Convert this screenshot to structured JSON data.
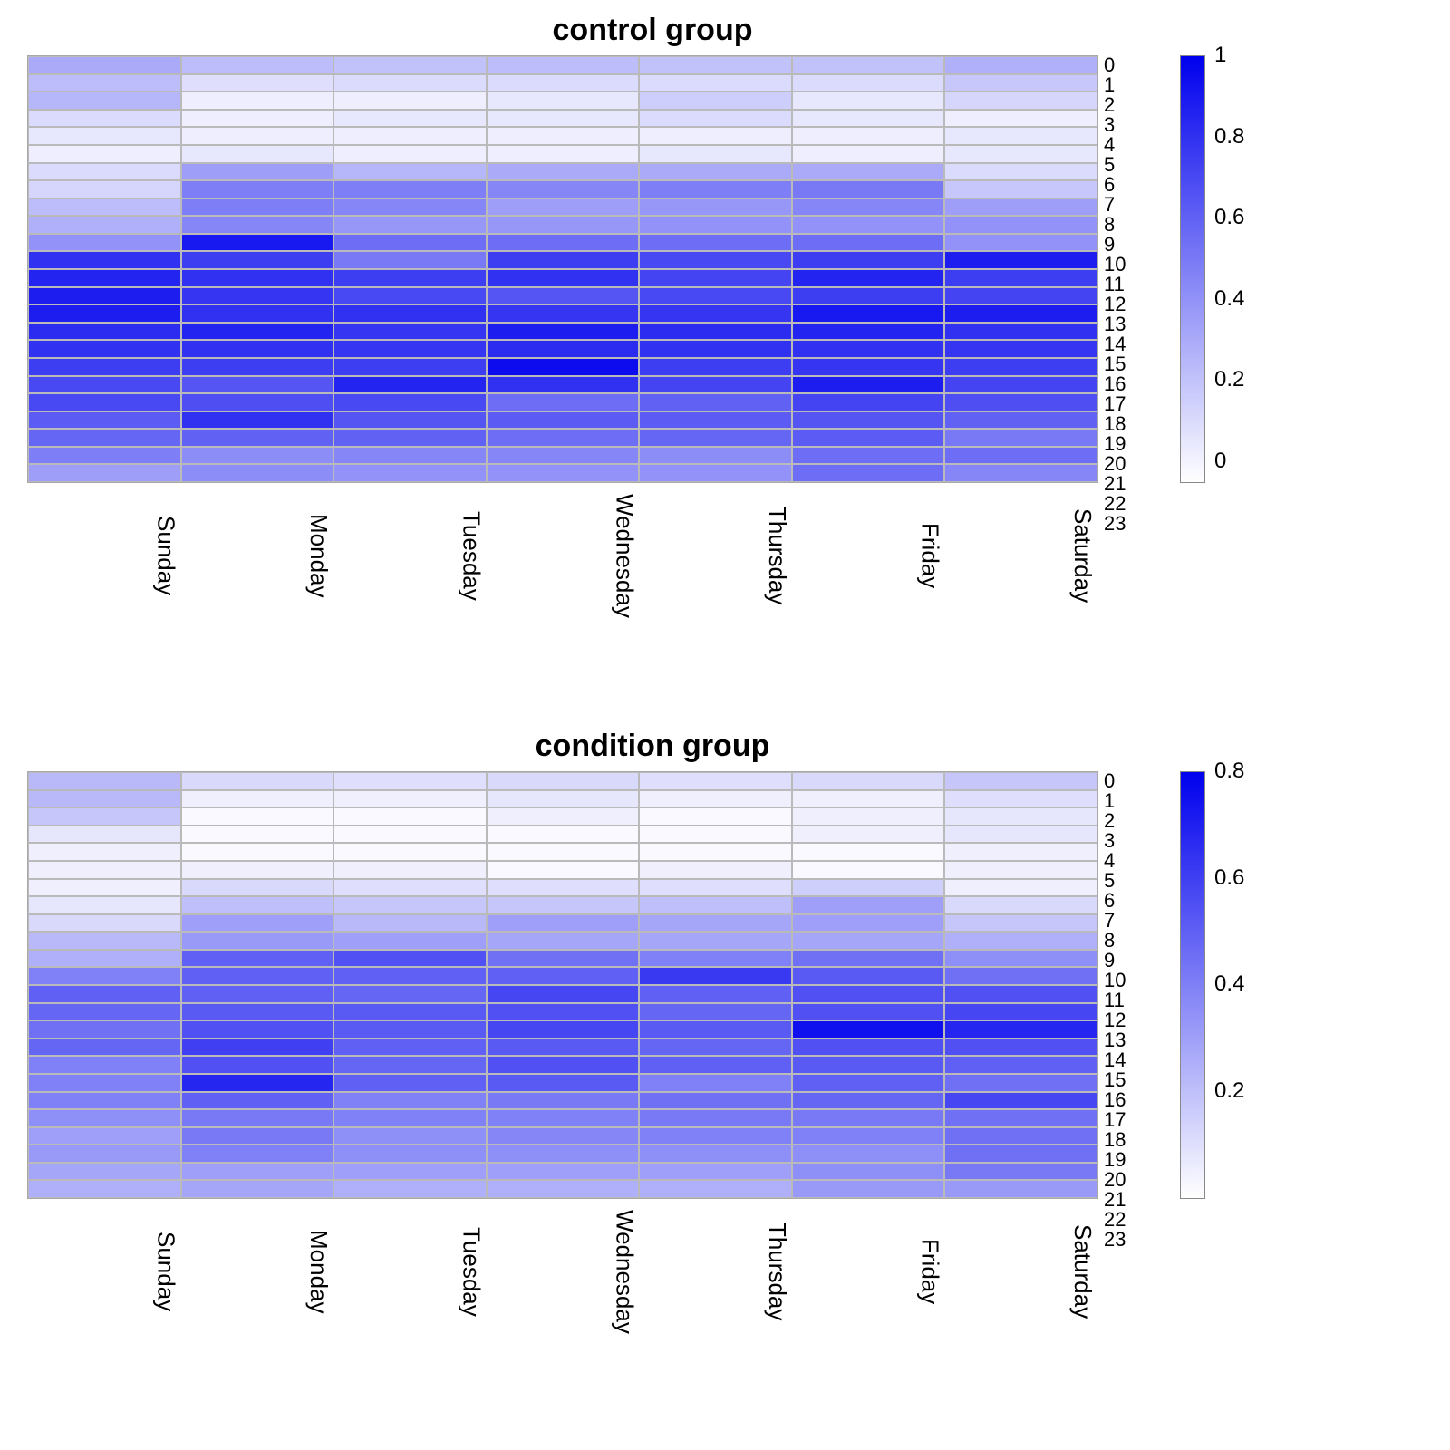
{
  "chart_data": [
    {
      "type": "heatmap",
      "title": "control group",
      "x_categories": [
        "Sunday",
        "Monday",
        "Tuesday",
        "Wednesday",
        "Thursday",
        "Friday",
        "Saturday"
      ],
      "y_categories": [
        "0",
        "1",
        "2",
        "3",
        "4",
        "5",
        "6",
        "7",
        "8",
        "9",
        "10",
        "11",
        "12",
        "13",
        "14",
        "15",
        "16",
        "17",
        "18",
        "19",
        "20",
        "21",
        "22",
        "23"
      ],
      "colorbar": {
        "min": -0.05,
        "max": 1.0,
        "ticks": [
          0,
          0.2,
          0.4,
          0.6,
          0.8,
          1
        ]
      },
      "colormap": {
        "low": "#ffffff",
        "high": "#0000ee"
      },
      "values": [
        [
          0.3,
          0.22,
          0.2,
          0.22,
          0.2,
          0.2,
          0.28
        ],
        [
          0.22,
          0.08,
          0.1,
          0.1,
          0.1,
          0.1,
          0.18
        ],
        [
          0.25,
          0.02,
          0.02,
          0.05,
          0.15,
          0.05,
          0.12
        ],
        [
          0.1,
          0.02,
          0.05,
          0.05,
          0.1,
          0.05,
          0.02
        ],
        [
          0.05,
          0.02,
          0.02,
          0.02,
          0.02,
          0.02,
          0.05
        ],
        [
          0.02,
          0.05,
          0.02,
          0.02,
          0.05,
          0.02,
          0.05
        ],
        [
          0.1,
          0.35,
          0.25,
          0.3,
          0.3,
          0.3,
          0.1
        ],
        [
          0.12,
          0.48,
          0.48,
          0.45,
          0.48,
          0.5,
          0.18
        ],
        [
          0.22,
          0.48,
          0.45,
          0.35,
          0.38,
          0.45,
          0.35
        ],
        [
          0.28,
          0.45,
          0.38,
          0.38,
          0.4,
          0.4,
          0.4
        ],
        [
          0.4,
          0.9,
          0.55,
          0.55,
          0.55,
          0.55,
          0.4
        ],
        [
          0.8,
          0.75,
          0.5,
          0.75,
          0.7,
          0.75,
          0.88
        ],
        [
          0.85,
          0.8,
          0.75,
          0.8,
          0.72,
          0.85,
          0.75
        ],
        [
          0.88,
          0.78,
          0.7,
          0.65,
          0.7,
          0.75,
          0.72
        ],
        [
          0.88,
          0.8,
          0.8,
          0.78,
          0.78,
          0.9,
          0.88
        ],
        [
          0.82,
          0.85,
          0.78,
          0.88,
          0.82,
          0.85,
          0.8
        ],
        [
          0.8,
          0.8,
          0.78,
          0.82,
          0.8,
          0.8,
          0.78
        ],
        [
          0.75,
          0.75,
          0.75,
          0.95,
          0.75,
          0.78,
          0.75
        ],
        [
          0.7,
          0.65,
          0.85,
          0.8,
          0.72,
          0.88,
          0.72
        ],
        [
          0.7,
          0.68,
          0.7,
          0.55,
          0.6,
          0.72,
          0.68
        ],
        [
          0.62,
          0.8,
          0.65,
          0.62,
          0.62,
          0.65,
          0.6
        ],
        [
          0.58,
          0.6,
          0.6,
          0.55,
          0.58,
          0.62,
          0.5
        ],
        [
          0.48,
          0.42,
          0.45,
          0.45,
          0.42,
          0.55,
          0.55
        ],
        [
          0.35,
          0.42,
          0.4,
          0.4,
          0.4,
          0.55,
          0.45
        ]
      ]
    },
    {
      "type": "heatmap",
      "title": "condition group",
      "x_categories": [
        "Sunday",
        "Monday",
        "Tuesday",
        "Wednesday",
        "Thursday",
        "Friday",
        "Saturday"
      ],
      "y_categories": [
        "0",
        "1",
        "2",
        "3",
        "4",
        "5",
        "6",
        "7",
        "8",
        "9",
        "10",
        "11",
        "12",
        "13",
        "14",
        "15",
        "16",
        "17",
        "18",
        "19",
        "20",
        "21",
        "22",
        "23"
      ],
      "colorbar": {
        "min": 0.0,
        "max": 0.8,
        "ticks": [
          0.2,
          0.4,
          0.6,
          0.8
        ]
      },
      "colormap": {
        "low": "#ffffff",
        "high": "#0000ee"
      },
      "values": [
        [
          0.22,
          0.12,
          0.1,
          0.12,
          0.1,
          0.12,
          0.18
        ],
        [
          0.22,
          0.05,
          0.05,
          0.08,
          0.05,
          0.05,
          0.1
        ],
        [
          0.18,
          0.02,
          0.02,
          0.05,
          0.02,
          0.05,
          0.08
        ],
        [
          0.08,
          0.02,
          0.02,
          0.02,
          0.02,
          0.05,
          0.08
        ],
        [
          0.05,
          0.02,
          0.02,
          0.02,
          0.02,
          0.02,
          0.05
        ],
        [
          0.05,
          0.05,
          0.05,
          0.02,
          0.05,
          0.02,
          0.05
        ],
        [
          0.05,
          0.12,
          0.1,
          0.1,
          0.1,
          0.15,
          0.05
        ],
        [
          0.08,
          0.2,
          0.18,
          0.18,
          0.2,
          0.3,
          0.12
        ],
        [
          0.12,
          0.3,
          0.22,
          0.3,
          0.28,
          0.3,
          0.18
        ],
        [
          0.22,
          0.32,
          0.3,
          0.28,
          0.28,
          0.28,
          0.25
        ],
        [
          0.25,
          0.5,
          0.55,
          0.45,
          0.4,
          0.45,
          0.35
        ],
        [
          0.4,
          0.5,
          0.5,
          0.5,
          0.62,
          0.52,
          0.45
        ],
        [
          0.5,
          0.5,
          0.48,
          0.58,
          0.5,
          0.55,
          0.55
        ],
        [
          0.48,
          0.52,
          0.52,
          0.55,
          0.48,
          0.55,
          0.58
        ],
        [
          0.45,
          0.55,
          0.52,
          0.58,
          0.52,
          0.75,
          0.68
        ],
        [
          0.48,
          0.6,
          0.5,
          0.52,
          0.48,
          0.55,
          0.55
        ],
        [
          0.4,
          0.55,
          0.48,
          0.55,
          0.5,
          0.52,
          0.5
        ],
        [
          0.4,
          0.68,
          0.5,
          0.52,
          0.4,
          0.5,
          0.45
        ],
        [
          0.4,
          0.5,
          0.4,
          0.42,
          0.45,
          0.48,
          0.58
        ],
        [
          0.35,
          0.42,
          0.4,
          0.4,
          0.42,
          0.42,
          0.45
        ],
        [
          0.3,
          0.42,
          0.35,
          0.38,
          0.4,
          0.4,
          0.45
        ],
        [
          0.32,
          0.4,
          0.35,
          0.35,
          0.35,
          0.35,
          0.45
        ],
        [
          0.28,
          0.3,
          0.3,
          0.3,
          0.3,
          0.35,
          0.42
        ],
        [
          0.25,
          0.28,
          0.25,
          0.25,
          0.25,
          0.32,
          0.32
        ]
      ]
    }
  ]
}
